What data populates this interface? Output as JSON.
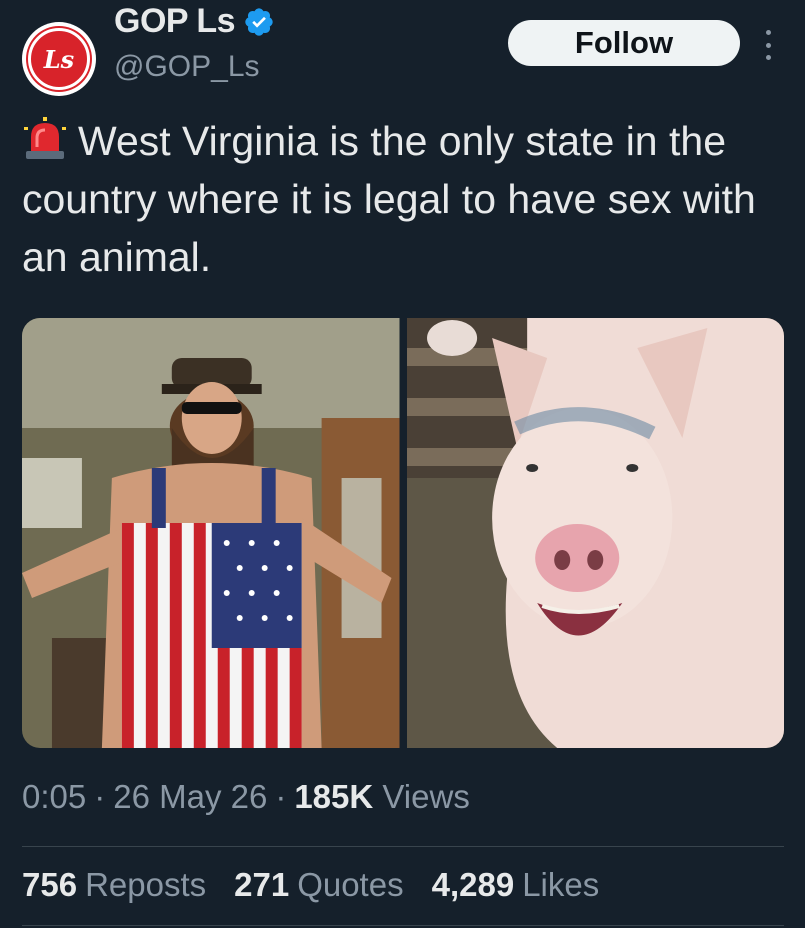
{
  "author": {
    "display_name": "GOP Ls",
    "handle": "@GOP_Ls",
    "avatar_text": "Ls",
    "verified": true
  },
  "follow_label": "Follow",
  "tweet": {
    "text": "West Virginia is the only state in the country where it is legal to have sex with an animal.",
    "emoji": "siren-icon"
  },
  "media": [
    {
      "description": "man-in-flag-overalls-photo"
    },
    {
      "description": "pig-photo"
    }
  ],
  "meta": {
    "time": "0:05",
    "date": "26 May 26",
    "views_count": "185K",
    "views_label": "Views"
  },
  "stats": {
    "reposts_count": "756",
    "reposts_label": "Reposts",
    "quotes_count": "271",
    "quotes_label": "Quotes",
    "likes_count": "4,289",
    "likes_label": "Likes"
  },
  "colors": {
    "background": "#15202b",
    "text": "#e7e9ea",
    "muted": "#8b98a5",
    "verified": "#1d9bf0",
    "avatar": "#d8232a"
  }
}
